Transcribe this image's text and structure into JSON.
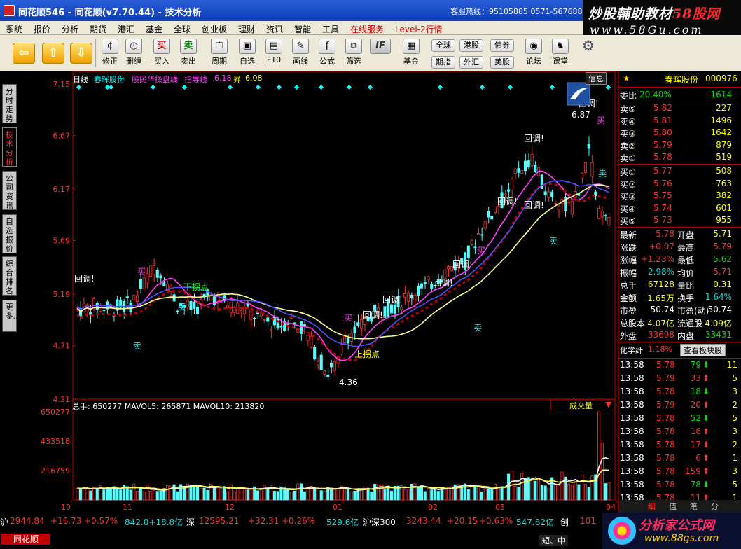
{
  "window": {
    "title": "同花顺546 - 同花顺(v7.70.44) - 技术分析",
    "hotline": "客服热线：95105885  0571-56768888"
  },
  "brand": {
    "line1_prefix": "炒股輔助教材",
    "line1_accent": "58股网",
    "line2": "www.58Gu.com"
  },
  "menu": [
    "系统",
    "报价",
    "分析",
    "期货",
    "港汇",
    "基金",
    "全球",
    "创业板",
    "理财",
    "资讯",
    "智能",
    "工具",
    "在线服务",
    "Level-2行情"
  ],
  "toolbar": {
    "buttons": [
      "修正",
      "删缠",
      "买入",
      "卖出",
      "周期",
      "自选",
      "F10",
      "画线",
      "公式",
      "筛选",
      "基金",
      "论坛",
      "课堂"
    ],
    "small_buttons": [
      "全球",
      "港股",
      "债券",
      "期指",
      "外汇",
      "美股"
    ],
    "buy_glyph": "买",
    "sell_glyph": "卖",
    "if_label": "IF"
  },
  "left_tabs": [
    "分时走势",
    "技术分析",
    "公司资讯",
    "自选报价",
    "综合排名",
    "更多..."
  ],
  "chart_header": {
    "period": "日线",
    "stock": "春晖股份",
    "indicator": "股民华操盘线",
    "guide_label": "指导线",
    "guide_value": "6.18",
    "rise_label": "昇",
    "rise_value": "6.08",
    "info_button": "信息"
  },
  "price_axis": [
    "7.15",
    "6.67",
    "6.17",
    "5.69",
    "5.19",
    "4.71",
    "4.21"
  ],
  "annotations": {
    "high": "6.87",
    "low": "4.36",
    "callbacks": "回调!",
    "buy": "买",
    "sell": "卖",
    "down_turn": "下拐点",
    "up_turn": "上拐点"
  },
  "volume_header": {
    "text": "总手: 650277  MAVOL5: 265871  MAVOL10: 213820",
    "dropdown": "成交量",
    "axis": [
      "650277",
      "433518",
      "216759"
    ]
  },
  "time_axis": [
    "10",
    "11",
    "12",
    "01",
    "02",
    "03",
    "04"
  ],
  "chart_data": {
    "type": "candlestick",
    "price_range": [
      4.21,
      7.15
    ],
    "volume_range": [
      0,
      650277
    ],
    "price_high": 6.87,
    "price_low": 4.36
  },
  "quote": {
    "name": "春晖股份",
    "code": "000976",
    "weibi_label": "委比",
    "weibi_pct": "20.40%",
    "weibi_diff": "-1614",
    "sells": [
      {
        "label": "卖⑤",
        "price": "5.82",
        "vol": "227"
      },
      {
        "label": "卖④",
        "price": "5.81",
        "vol": "1496"
      },
      {
        "label": "卖③",
        "price": "5.80",
        "vol": "1642"
      },
      {
        "label": "卖②",
        "price": "5.79",
        "vol": "879"
      },
      {
        "label": "卖①",
        "price": "5.78",
        "vol": "519"
      }
    ],
    "buys": [
      {
        "label": "买①",
        "price": "5.77",
        "vol": "508"
      },
      {
        "label": "买②",
        "price": "5.76",
        "vol": "763"
      },
      {
        "label": "买③",
        "price": "5.75",
        "vol": "382"
      },
      {
        "label": "买④",
        "price": "5.74",
        "vol": "601"
      },
      {
        "label": "买⑤",
        "price": "5.73",
        "vol": "955"
      }
    ],
    "stats": [
      {
        "l1": "最新",
        "v1": "5.78",
        "l2": "开盘",
        "v2": "5.71"
      },
      {
        "l1": "涨跌",
        "v1": "+0.07",
        "l2": "最高",
        "v2": "5.79"
      },
      {
        "l1": "涨幅",
        "v1": "+1.23%",
        "l2": "最低",
        "v2": "5.62"
      },
      {
        "l1": "振幅",
        "v1": "2.98%",
        "l2": "均价",
        "v2": "5.71"
      },
      {
        "l1": "总手",
        "v1": "67128",
        "l2": "量比",
        "v2": "0.31"
      },
      {
        "l1": "金额",
        "v1": "1.65万",
        "l2": "换手",
        "v2": "1.64%"
      },
      {
        "l1": "市盈",
        "v1": "50.74",
        "l2": "市盈(动)",
        "v2": "50.74"
      },
      {
        "l1": "总股本",
        "v1": "4.07亿",
        "l2": "流通股",
        "v2": "4.09亿"
      },
      {
        "l1": "外盘",
        "v1": "33698",
        "l2": "内盘",
        "v2": "33431"
      }
    ],
    "sector_label": "化学纤",
    "sector_pct": "1.18%",
    "sector_button": "查看板块股",
    "ticks": [
      {
        "t": "13:58",
        "p": "5.78",
        "v": "79",
        "dir": "down",
        "n": "11"
      },
      {
        "t": "13:58",
        "p": "5.79",
        "v": "33",
        "dir": "up",
        "n": "5"
      },
      {
        "t": "13:58",
        "p": "5.78",
        "v": "18",
        "dir": "down",
        "n": "3"
      },
      {
        "t": "13:58",
        "p": "5.79",
        "v": "20",
        "dir": "up",
        "n": "2"
      },
      {
        "t": "13:58",
        "p": "5.78",
        "v": "52",
        "dir": "down",
        "n": "5"
      },
      {
        "t": "13:58",
        "p": "5.78",
        "v": "16",
        "dir": "up",
        "n": "3"
      },
      {
        "t": "13:58",
        "p": "5.78",
        "v": "17",
        "dir": "up",
        "n": "2"
      },
      {
        "t": "13:58",
        "p": "5.78",
        "v": "6",
        "dir": "up",
        "n": "1"
      },
      {
        "t": "13:58",
        "p": "5.78",
        "v": "159",
        "dir": "up",
        "n": "3"
      },
      {
        "t": "13:58",
        "p": "5.78",
        "v": "78",
        "dir": "down",
        "n": "5"
      },
      {
        "t": "13:58",
        "p": "5.78",
        "v": "11",
        "dir": "up",
        "n": "1"
      }
    ],
    "bottom_tabs": [
      "细",
      "值",
      "笔",
      "分"
    ]
  },
  "index_bar": {
    "sh_label": "沪",
    "sh": "2944.84",
    "sh_chg": "+16.73",
    "sh_pct": "+0.57%",
    "sh_amt": "842.0+18.8亿",
    "sz_label": "深",
    "sz": "12595.21",
    "sz_chg": "+32.31",
    "sz_pct": "+0.26%",
    "sz_amt": "529.6亿",
    "hs_label": "沪深300",
    "hs": "3243.44",
    "hs_chg": "+20.15",
    "hs_pct": "+0.63%",
    "hs_amt": "547.82亿",
    "cy_label": "创",
    "cy": "101",
    "app": "同花顺",
    "shortcut": "短、中"
  },
  "logo2": {
    "line1": "分析家公式网",
    "line2": "www.88gs.com"
  },
  "colors": {
    "up": "#ff3030",
    "down": "#00e0e0",
    "ma_purple": "#ff40ff",
    "ma_yellow": "#ffff80"
  }
}
